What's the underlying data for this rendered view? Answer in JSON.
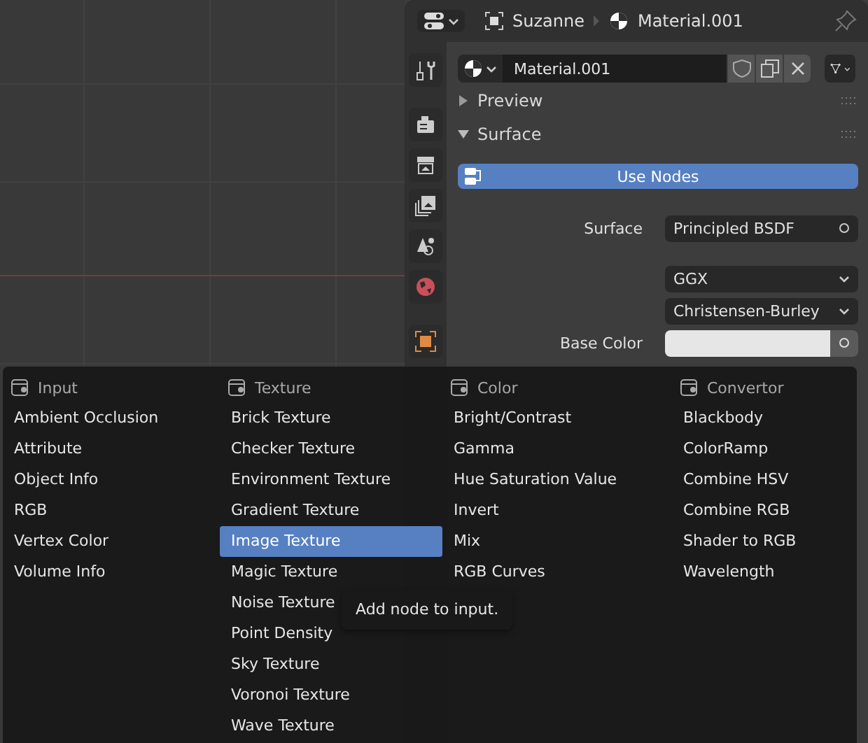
{
  "header": {
    "object": "Suzanne",
    "material": "Material.001"
  },
  "material_slot": {
    "name": "Material.001"
  },
  "panels": [
    {
      "title": "Preview",
      "expanded": false
    },
    {
      "title": "Surface",
      "expanded": true
    }
  ],
  "use_nodes": "Use Nodes",
  "fields": [
    {
      "kind": "socket",
      "label": "Surface",
      "value": "Principled BSDF"
    },
    {
      "kind": "select",
      "value": "GGX"
    },
    {
      "kind": "select",
      "value": "Christensen-Burley"
    },
    {
      "kind": "color",
      "label": "Base Color"
    }
  ],
  "menu": {
    "columns": [
      {
        "title": "Input",
        "items": [
          {
            "label": "Ambient Occlusion",
            "selected": false
          },
          {
            "label": "Attribute",
            "selected": false
          },
          {
            "label": "Object Info",
            "selected": false
          },
          {
            "label": "RGB",
            "selected": false
          },
          {
            "label": "Vertex Color",
            "selected": false
          },
          {
            "label": "Volume Info",
            "selected": false
          }
        ]
      },
      {
        "title": "Texture",
        "items": [
          {
            "label": "Brick Texture",
            "selected": false
          },
          {
            "label": "Checker Texture",
            "selected": false
          },
          {
            "label": "Environment Texture",
            "selected": false
          },
          {
            "label": "Gradient Texture",
            "selected": false
          },
          {
            "label": "Image Texture",
            "selected": true
          },
          {
            "label": "Magic Texture",
            "selected": false
          },
          {
            "label": "Noise Texture",
            "selected": false
          },
          {
            "label": "Point Density",
            "selected": false
          },
          {
            "label": "Sky Texture",
            "selected": false
          },
          {
            "label": "Voronoi Texture",
            "selected": false
          },
          {
            "label": "Wave Texture",
            "selected": false
          }
        ]
      },
      {
        "title": "Color",
        "items": [
          {
            "label": "Bright/Contrast",
            "selected": false
          },
          {
            "label": "Gamma",
            "selected": false
          },
          {
            "label": "Hue Saturation Value",
            "selected": false
          },
          {
            "label": "Invert",
            "selected": false
          },
          {
            "label": "Mix",
            "selected": false
          },
          {
            "label": "RGB Curves",
            "selected": false
          }
        ]
      },
      {
        "title": "Convertor",
        "items": [
          {
            "label": "Blackbody",
            "selected": false
          },
          {
            "label": "ColorRamp",
            "selected": false
          },
          {
            "label": "Combine HSV",
            "selected": false
          },
          {
            "label": "Combine RGB",
            "selected": false
          },
          {
            "label": "Shader to RGB",
            "selected": false
          },
          {
            "label": "Wavelength",
            "selected": false
          }
        ]
      }
    ]
  },
  "tooltip": "Add node to input."
}
